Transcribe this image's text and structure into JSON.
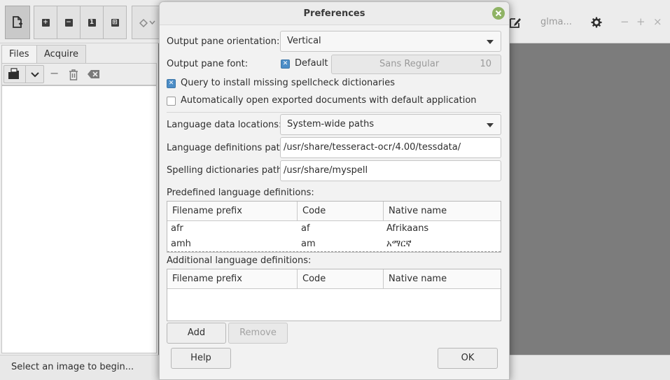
{
  "app": {
    "header_label": "glma...",
    "tabs": [
      {
        "label": "Files",
        "active": true
      },
      {
        "label": "Acquire",
        "active": false
      }
    ],
    "status_text": "Select an image to begin..."
  },
  "dialog": {
    "title": "Preferences",
    "output_pane_orientation": {
      "label": "Output pane orientation:",
      "value": "Vertical"
    },
    "output_pane_font": {
      "label": "Output pane font:",
      "default_label": "Default",
      "default_checked": true,
      "font_name": "Sans Regular",
      "font_size": "10"
    },
    "query_spellcheck": {
      "label": "Query to install missing spellcheck dictionaries",
      "checked": true
    },
    "auto_open": {
      "label": "Automatically open exported documents with default application",
      "checked": false
    },
    "language_data_locations": {
      "label": "Language data locations:",
      "value": "System-wide paths"
    },
    "language_definitions_path": {
      "label": "Language definitions path:",
      "value": "/usr/share/tesseract-ocr/4.00/tessdata/"
    },
    "spelling_dictionaries_path": {
      "label": "Spelling dictionaries path:",
      "value": "/usr/share/myspell"
    },
    "predefined": {
      "label": "Predefined language definitions:",
      "columns": [
        "Filename prefix",
        "Code",
        "Native name"
      ],
      "rows": [
        [
          "afr",
          "af",
          "Afrikaans"
        ],
        [
          "amh",
          "am",
          "አማርኛ"
        ]
      ]
    },
    "additional": {
      "label": "Additional language definitions:",
      "columns": [
        "Filename prefix",
        "Code",
        "Native name"
      ],
      "rows": []
    },
    "buttons": {
      "add": "Add",
      "remove": "Remove",
      "help": "Help",
      "ok": "OK"
    },
    "colors": {
      "close_button": "#8fb365",
      "checkbox_checked": "#4c8dc7"
    }
  }
}
